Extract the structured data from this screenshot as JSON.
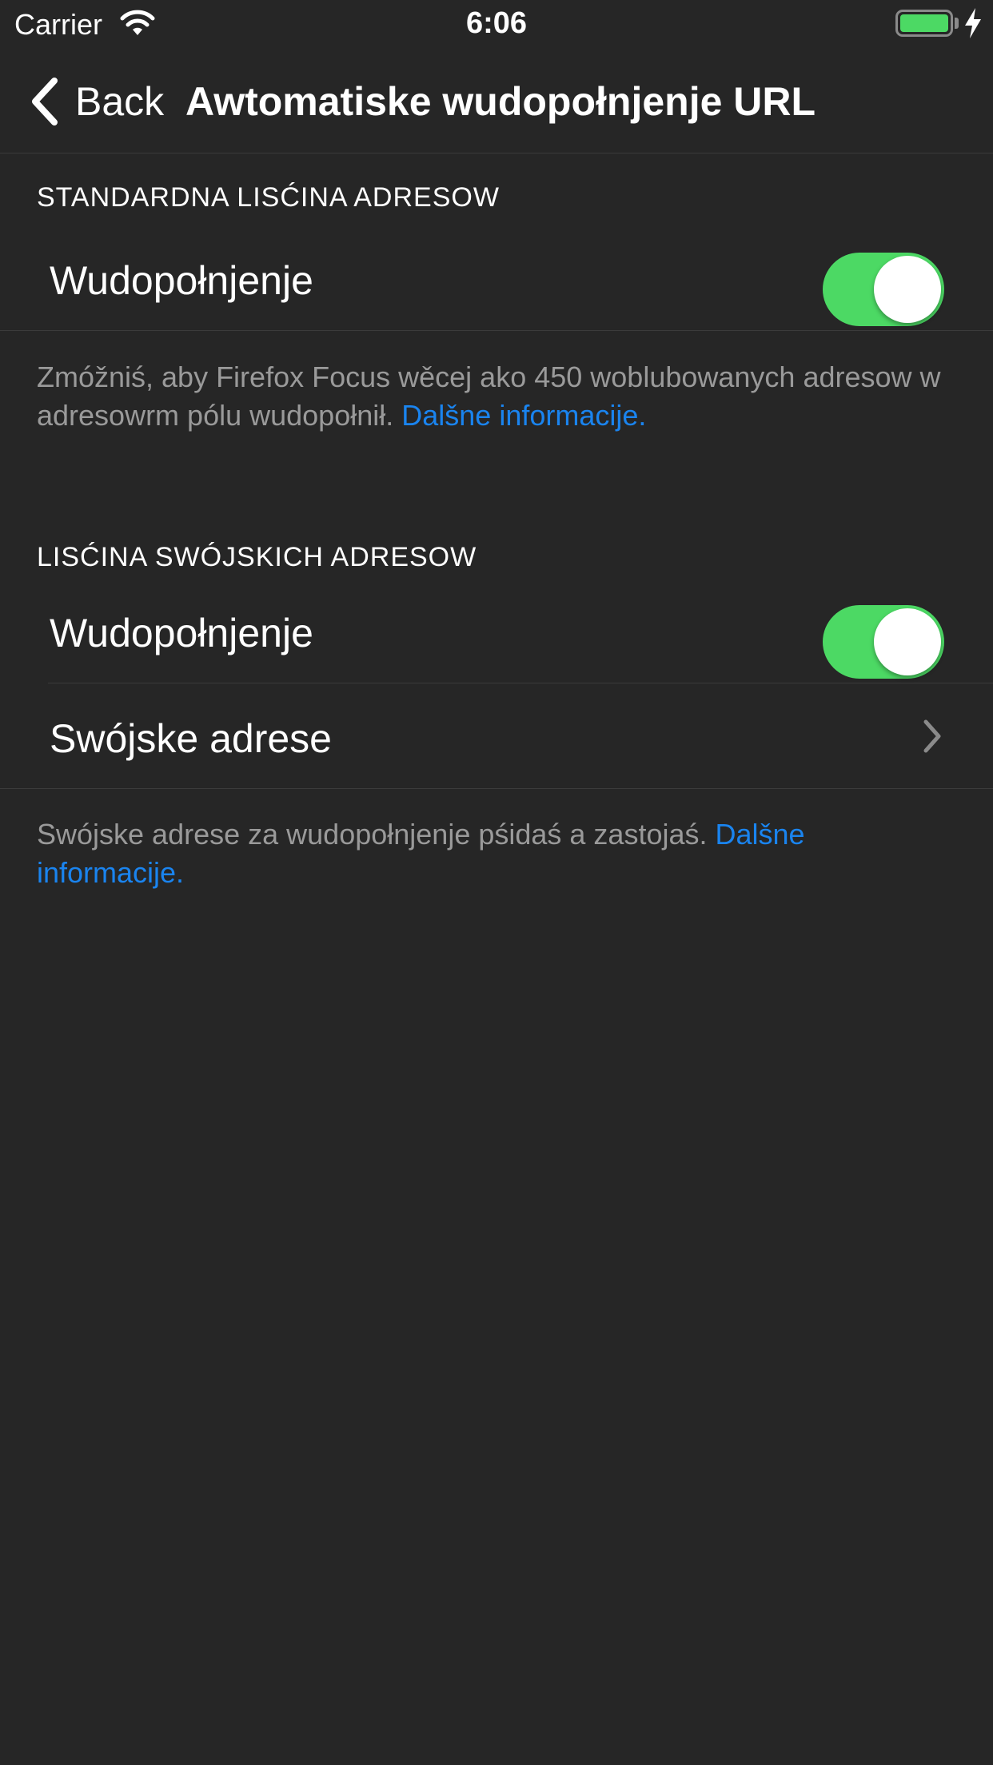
{
  "status_bar": {
    "carrier": "Carrier",
    "time": "6:06",
    "battery_level": 1.0,
    "charging": true
  },
  "nav": {
    "back_label": "Back",
    "title": "Awtomatiske wudopołnjenje URL"
  },
  "sections": [
    {
      "header": "STANDARDNA LISĆINA ADRESOW",
      "rows": [
        {
          "label": "Wudopołnjenje",
          "toggle_on": true
        }
      ],
      "footer_text": "Zmóžniś, aby Firefox Focus wěcej ako 450 woblubowanych adresow w adresowrm pólu wudopołnił.",
      "footer_link": "Dalšne informacije."
    },
    {
      "header": "LISĆINA SWÓJSKICH ADRESOW",
      "rows": [
        {
          "label": "Wudopołnjenje",
          "toggle_on": true
        },
        {
          "label": "Swójske adrese"
        }
      ],
      "footer_text": "Swójske adrese za wudopołnjenje pśidaś a zastojaś.",
      "footer_link": "Dalšne informacije."
    }
  ],
  "colors": {
    "background": "#262626",
    "toggle_on": "#4cd964",
    "link": "#1a84ef",
    "footer_text": "#9a9a9a",
    "separator": "#3b3b3b"
  },
  "icons": [
    "wifi-icon",
    "battery-icon",
    "charging-bolt-icon",
    "back-chevron-icon",
    "chevron-right-icon"
  ]
}
